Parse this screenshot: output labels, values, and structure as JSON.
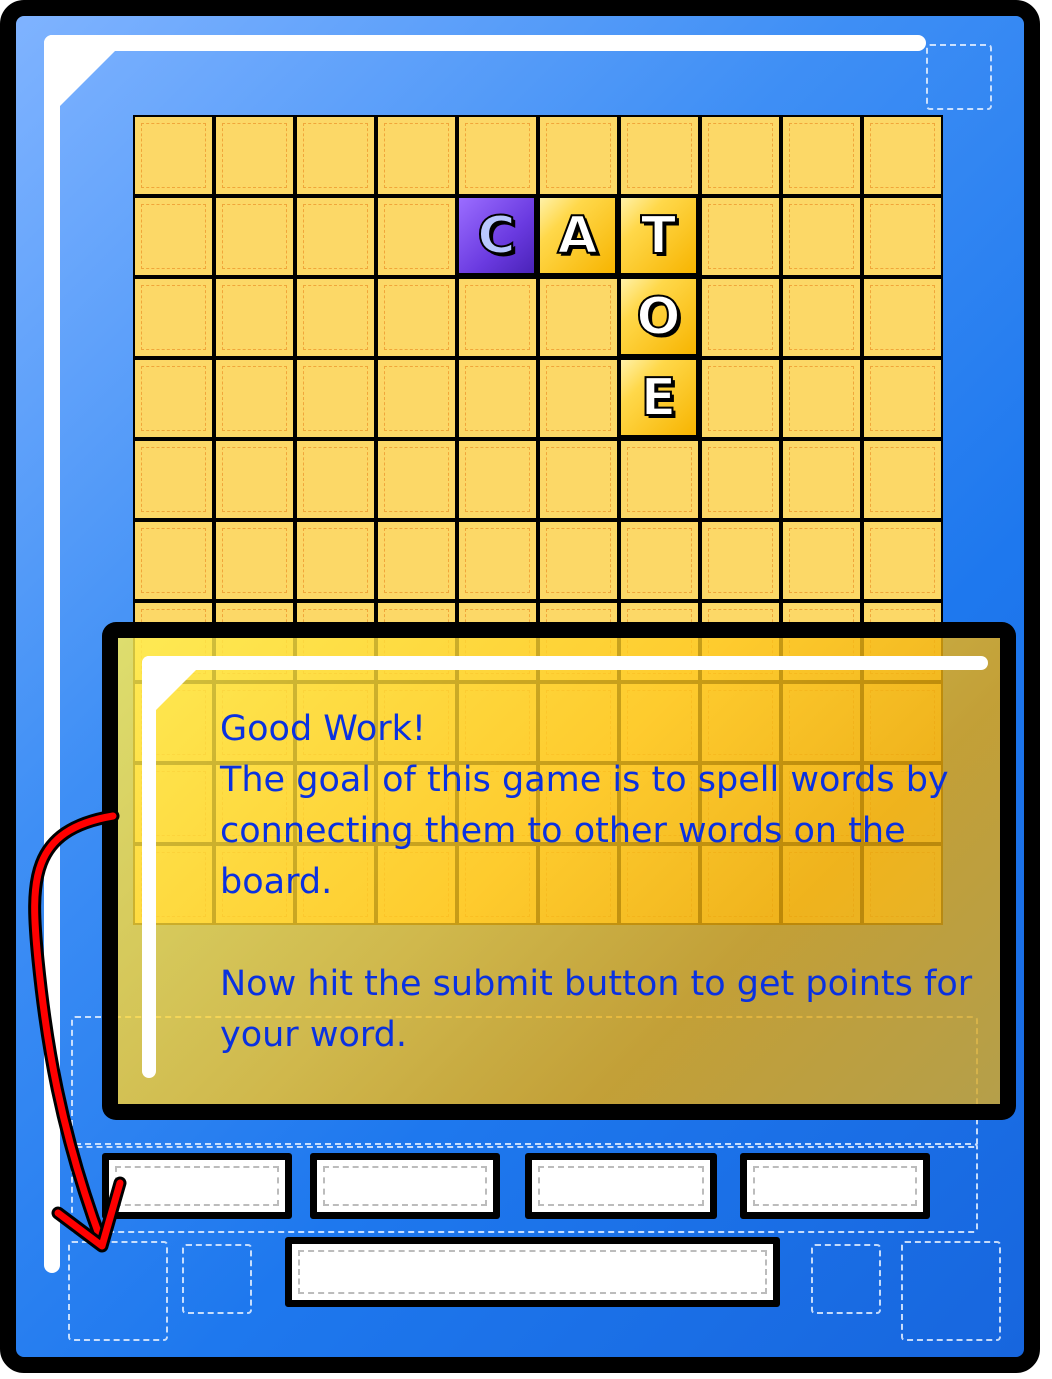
{
  "board": {
    "rows": [
      [
        "",
        "",
        "",
        "",
        "",
        "",
        "",
        "",
        "",
        ""
      ],
      [
        "",
        "",
        "",
        "",
        "C",
        "A",
        "T",
        "",
        "",
        ""
      ],
      [
        "",
        "",
        "",
        "",
        "",
        "",
        "O",
        "",
        "",
        ""
      ],
      [
        "",
        "",
        "",
        "",
        "",
        "",
        "E",
        "",
        "",
        ""
      ],
      [
        "",
        "",
        "",
        "",
        "",
        "",
        "",
        "",
        "",
        ""
      ],
      [
        "",
        "",
        "",
        "",
        "",
        "",
        "",
        "",
        "",
        ""
      ],
      [
        "",
        "",
        "",
        "",
        "",
        "",
        "",
        "",
        "",
        ""
      ],
      [
        "",
        "",
        "",
        "",
        "",
        "",
        "",
        "",
        "",
        ""
      ],
      [
        "",
        "",
        "",
        "",
        "",
        "",
        "",
        "",
        "",
        ""
      ],
      [
        "",
        "",
        "",
        "",
        "",
        "",
        "",
        "",
        "",
        ""
      ]
    ],
    "highlighted_tile": "C"
  },
  "tutorial": {
    "heading": "Good Work!",
    "line1": "The goal of this game is to spell words by connecting them to other words on the board.",
    "line2": "Now hit the submit button to get points for your word."
  },
  "controls": {
    "slots": [
      "",
      "",
      "",
      ""
    ],
    "submit_label": ""
  },
  "colors": {
    "frame_blue": "#1e78ee",
    "board_yellow": "#fcd867",
    "tile_gold": "#ffd84a",
    "tile_purple": "#6a3ae0",
    "instruction_text": "#0a31e0",
    "arrow_red": "#ff0000"
  }
}
